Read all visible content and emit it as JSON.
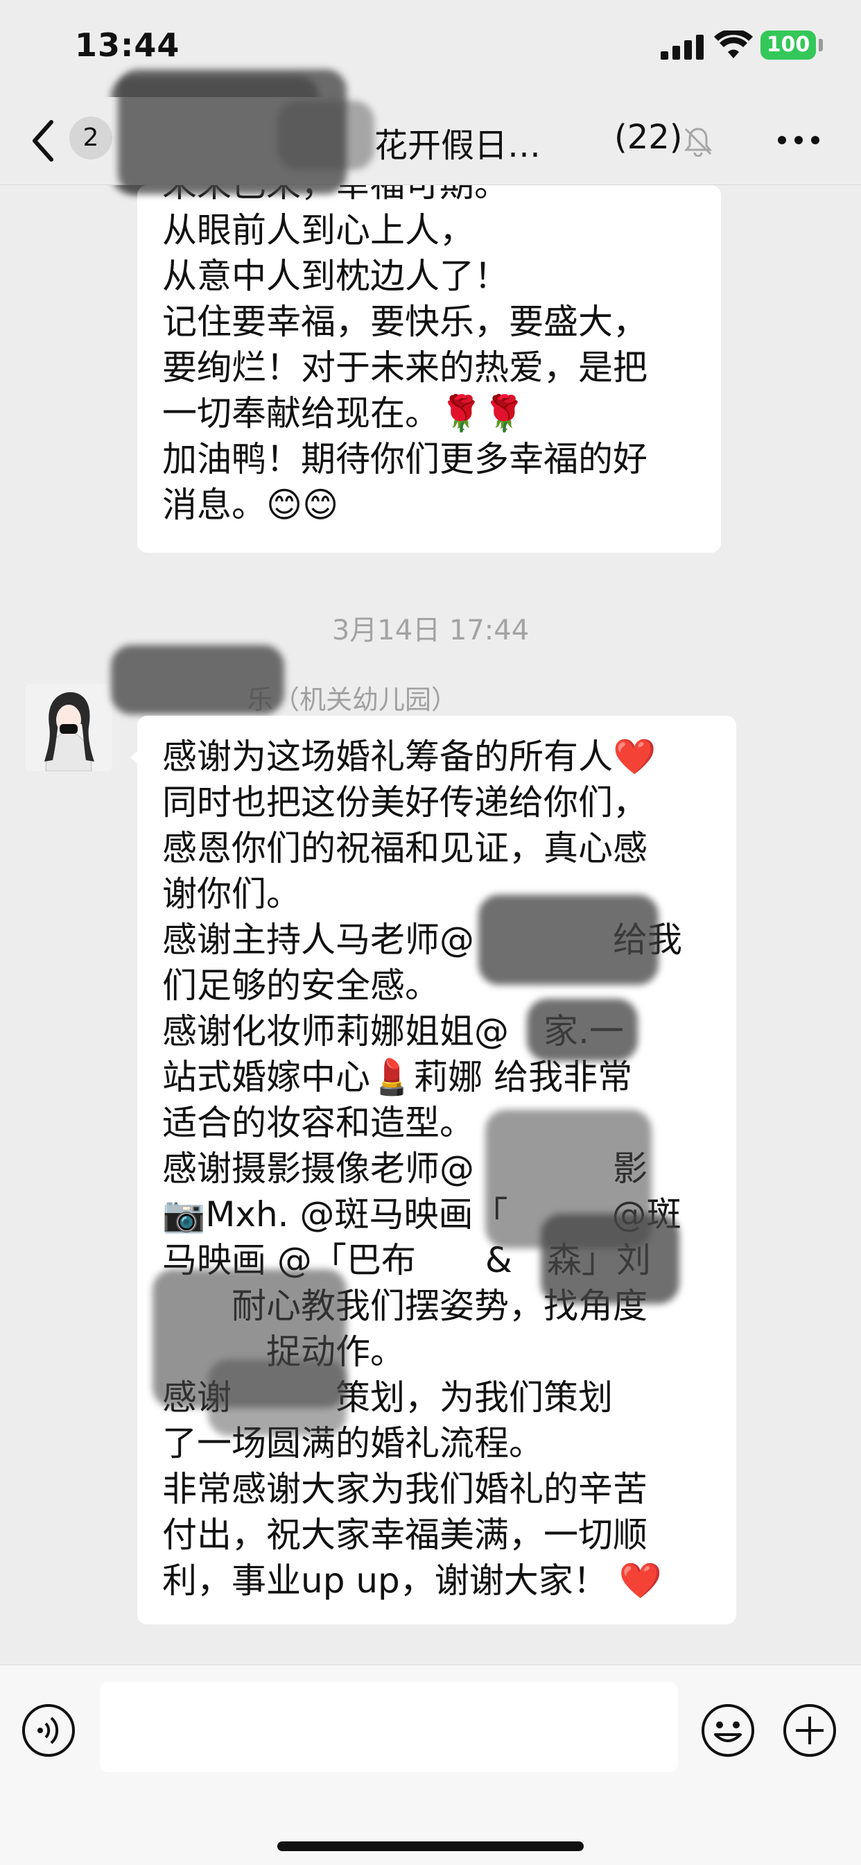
{
  "status_bar": {
    "time": "13:44",
    "battery": "100",
    "battery_color": "#34c759"
  },
  "nav": {
    "unread_count": "2",
    "title": "花开假日…",
    "member_count": "(22)",
    "icons": [
      "back-icon",
      "mute-icon",
      "more-icon"
    ]
  },
  "messages": {
    "first": {
      "text": "未来已来，幸福可期。\n从眼前人到心上人，\n从意中人到枕边人了！\n记住要幸福，要快乐，要盛大，\n要绚烂！对于未来的热爱，是把\n一切奉献给现在。🌹🌹\n加油鸭！期待你们更多幸福的好\n消息。😊😊"
    },
    "timestamp": "3月14日 17:44",
    "second": {
      "sender": "乐（机关幼儿园）",
      "text": "感谢为这场婚礼筹备的所有人❤️\n同时也把这份美好传递给你们，\n感恩你们的祝福和见证，真心感\n谢你们。\n感谢主持人马老师@　　　　给我\n们足够的安全感。\n感谢化妆师莉娜姐姐@　家.一\n站式婚嫁中心💄莉娜 给我非常\n适合的妆容和造型。\n感谢摄影摄像老师@　　　　影\n📷Mxh. @斑马映画「　　　@斑\n马映画 @「巴布　　&　森」刘\n　　耐心教我们摆姿势，找角度\n　　　捉动作。\n感谢　　　策划，为我们策划\n了一场圆满的婚礼流程。\n非常感谢大家为我们婚礼的辛苦\n付出，祝大家幸福美满，一切顺\n利，事业up up，谢谢大家！ ❤️"
    }
  },
  "input_bar": {
    "placeholder": "",
    "icons": [
      "voice-icon",
      "emoji-icon",
      "plus-icon"
    ]
  }
}
